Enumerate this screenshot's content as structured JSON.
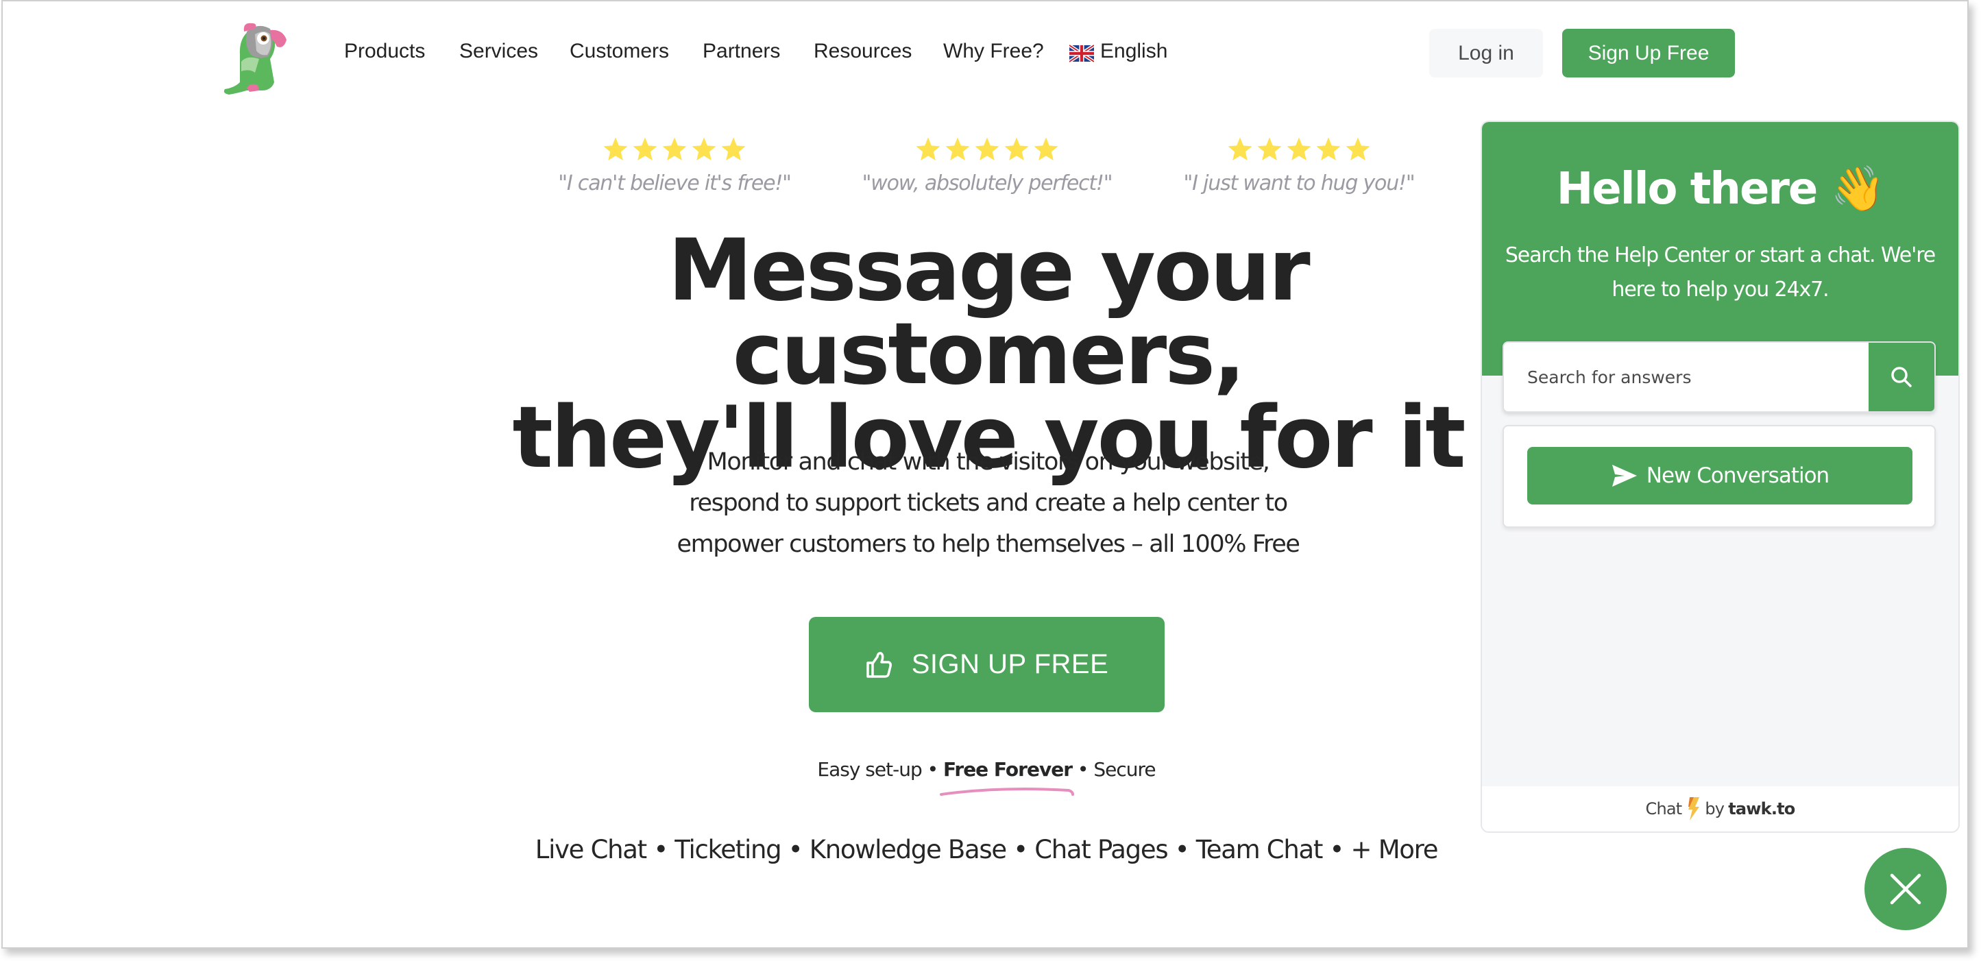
{
  "header": {
    "logo_alt": "tawk.to parrot logo",
    "nav": [
      {
        "label": "Products"
      },
      {
        "label": "Services"
      },
      {
        "label": "Customers"
      },
      {
        "label": "Partners"
      },
      {
        "label": "Resources"
      },
      {
        "label": "Why Free?"
      }
    ],
    "language": {
      "label": "English",
      "flag_icon": "uk-flag-icon"
    },
    "login_label": "Log in",
    "signup_label": "Sign Up Free"
  },
  "testimonials": [
    {
      "rating": 5,
      "max_rating": 5,
      "quote": "\"I can't believe it's free!\""
    },
    {
      "rating": 5,
      "max_rating": 5,
      "quote": "\"wow, absolutely perfect!\""
    },
    {
      "rating": 5,
      "max_rating": 5,
      "quote": "\"I just want to hug you!\""
    }
  ],
  "hero": {
    "headline_line1": "Message your customers,",
    "headline_line2": "they'll love you for it",
    "subtext_line1": "Monitor and chat with the visitors on your website,",
    "subtext_line2": "respond to support tickets and create a help center to",
    "subtext_line3": "empower customers to help themselves – all 100% Free",
    "cta_label": "SIGN UP FREE",
    "cta_icon": "thumbs-up-icon",
    "tagline": {
      "part1": "Easy set-up •",
      "highlight": "Free Forever",
      "part2": "• Secure"
    },
    "features": "Live Chat • Ticketing • Knowledge Base • Chat Pages • Team Chat • + More"
  },
  "chat_widget": {
    "title": "Hello there",
    "title_emoji": "👋",
    "subtitle": "Search the Help Center or start a chat. We're here to help you 24x7.",
    "search_placeholder": "Search for answers",
    "new_conversation_label": "New Conversation",
    "footer_prefix": "Chat",
    "footer_by": "by",
    "footer_brand": "tawk.to"
  },
  "colors": {
    "brand_green": "#4ca55a",
    "star_yellow": "#fde14f",
    "heading_text": "#242424",
    "quote_grey": "#9a9aa2",
    "accent_pink": "#e68fbf"
  }
}
